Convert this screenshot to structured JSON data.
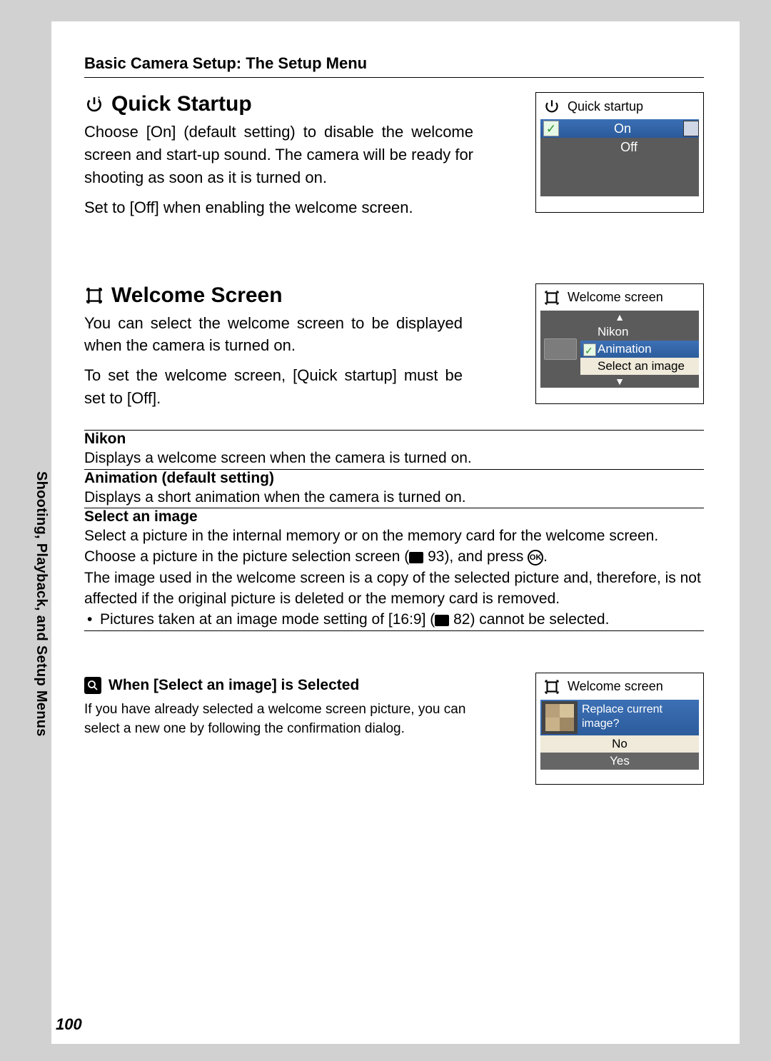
{
  "breadcrumb": "Basic Camera Setup: The Setup Menu",
  "sidetab": "Shooting, Playback, and Setup Menus",
  "page_number": "100",
  "section1": {
    "title": "Quick Startup",
    "para1": "Choose [On] (default setting) to disable the welcome screen and start-up sound. The camera will be ready for shooting as soon as it is turned on.",
    "para2": "Set to [Off] when enabling the welcome screen.",
    "lcd": {
      "title": "Quick startup",
      "on": "On",
      "off": "Off"
    }
  },
  "section2": {
    "title": "Welcome Screen",
    "para1": "You can select the welcome screen to be displayed when the camera is turned on.",
    "para2": "To set the welcome screen, [Quick startup] must be set to [Off].",
    "lcd": {
      "title": "Welcome screen",
      "opt1": "Nikon",
      "opt2": "Animation",
      "opt3": "Select an image"
    },
    "table": {
      "row1_head": "Nikon",
      "row1_body": "Displays a welcome screen when the camera is turned on.",
      "row2_head": "Animation (default setting)",
      "row2_body": "Displays a short animation when the camera is turned on.",
      "row3_head": "Select an image",
      "row3_p1a": "Select a picture in the internal memory or on the memory card for the welcome screen. Choose a picture in the picture selection screen (",
      "row3_p1_ref": " 93), and press ",
      "row3_p1_end": ".",
      "row3_p2": "The image used in the welcome screen is a copy of the selected picture and, therefore, is not affected if the original picture is deleted or the memory card is removed.",
      "row3_bullet_a": "Pictures taken at an image mode setting of [16:9] (",
      "row3_bullet_ref": " 82) cannot be selected."
    }
  },
  "note": {
    "title": "When [Select an image] is Selected",
    "text": "If you have already selected a welcome screen picture, you can select a new one by following the confirmation dialog.",
    "lcd": {
      "title": "Welcome screen",
      "question_l1": "Replace current",
      "question_l2": "image?",
      "no": "No",
      "yes": "Yes"
    }
  }
}
